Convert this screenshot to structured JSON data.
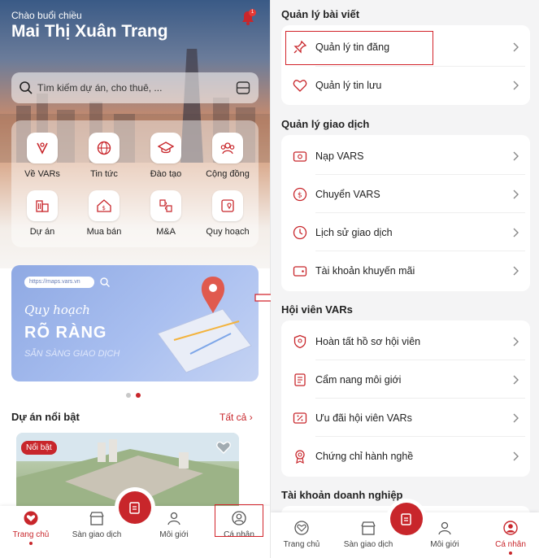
{
  "left": {
    "greeting": "Chào buổi chiều",
    "user_name": "Mai Thị Xuân Trang",
    "notification_count": "1",
    "search": {
      "placeholder": "Tìm kiếm dự án, cho thuê, ..."
    },
    "menu": [
      {
        "label": "Về VARs",
        "icon": "vars-icon"
      },
      {
        "label": "Tin tức",
        "icon": "news-icon"
      },
      {
        "label": "Đào tạo",
        "icon": "graduation-cap-icon"
      },
      {
        "label": "Cộng đồng",
        "icon": "community-icon"
      },
      {
        "label": "Dự án",
        "icon": "buildings-icon"
      },
      {
        "label": "Mua bán",
        "icon": "house-price-icon"
      },
      {
        "label": "M&A",
        "icon": "puzzle-icon"
      },
      {
        "label": "Quy hoạch",
        "icon": "map-pin-icon"
      }
    ],
    "banner": {
      "url": "https://maps.vars.vn",
      "script": "Quy hoạch",
      "headline": "RÕ RÀNG",
      "subline": "SẴN SÀNG GIAO DỊCH"
    },
    "featured": {
      "title": "Dự án nổi bật",
      "see_all": "Tất cả",
      "badge": "Nổi bật"
    },
    "tabs": [
      {
        "label": "Trang chủ",
        "icon": "home-icon",
        "active": true
      },
      {
        "label": "Sàn giao dịch",
        "icon": "market-icon",
        "active": false
      },
      {
        "label": "Môi giới",
        "icon": "broker-icon",
        "active": false
      },
      {
        "label": "Cá nhân",
        "icon": "profile-icon",
        "active": false
      }
    ]
  },
  "right": {
    "sections": [
      {
        "title": "Quản lý bài viết",
        "items": [
          {
            "label": "Quản lý tin đăng",
            "icon": "pin-icon"
          },
          {
            "label": "Quản lý tin lưu",
            "icon": "heart-icon"
          }
        ]
      },
      {
        "title": "Quản lý giao dịch",
        "items": [
          {
            "label": "Nạp VARS",
            "icon": "topup-icon"
          },
          {
            "label": "Chuyển VARS",
            "icon": "coin-icon"
          },
          {
            "label": "Lịch sử giao dịch",
            "icon": "history-icon"
          },
          {
            "label": "Tài khoản khuyến mãi",
            "icon": "wallet-icon"
          }
        ]
      },
      {
        "title": "Hội viên VARs",
        "items": [
          {
            "label": "Hoàn tất hồ sơ hội viên",
            "icon": "member-badge-icon"
          },
          {
            "label": "Cẩm nang môi giới",
            "icon": "handbook-icon"
          },
          {
            "label": "Ưu đãi hội viên VARs",
            "icon": "discount-icon"
          },
          {
            "label": "Chứng chỉ hành nghề",
            "icon": "certificate-icon"
          }
        ]
      },
      {
        "title": "Tài khoản doanh nghiệp",
        "items": []
      }
    ],
    "tabs": [
      {
        "label": "Trang chủ",
        "icon": "home-icon",
        "active": false
      },
      {
        "label": "Sàn giao dịch",
        "icon": "market-icon",
        "active": false
      },
      {
        "label": "Môi giới",
        "icon": "broker-icon",
        "active": false
      },
      {
        "label": "Cá nhân",
        "icon": "profile-icon",
        "active": true
      }
    ]
  },
  "colors": {
    "brand": "#c8262b",
    "highlight_box": "#d2232a",
    "background_right": "#f4f4f5"
  }
}
